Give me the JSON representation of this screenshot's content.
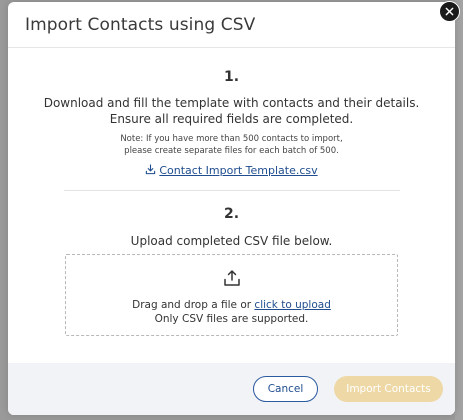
{
  "modal": {
    "title": "Import Contacts using CSV"
  },
  "step1": {
    "number": "1.",
    "instruction_line1": "Download and fill the template with contacts and their details.",
    "instruction_line2": "Ensure all required fields are completed.",
    "note_line1": "Note: If you have more than 500 contacts to import,",
    "note_line2": "please create separate files for each batch of 500.",
    "template_link": "Contact Import Template.csv",
    "template_icon": "download-icon"
  },
  "step2": {
    "number": "2.",
    "instruction": "Upload completed CSV file below.",
    "dropzone": {
      "icon": "upload-icon",
      "text_prefix": "Drag and drop a file or ",
      "link": "click to upload",
      "support_text": "Only CSV files are supported."
    }
  },
  "footer": {
    "cancel_label": "Cancel",
    "import_label": "Import Contacts"
  },
  "colors": {
    "link": "#1f4d8f",
    "import_disabled": "#eed9a6",
    "close_button": "#1b1b1b"
  }
}
